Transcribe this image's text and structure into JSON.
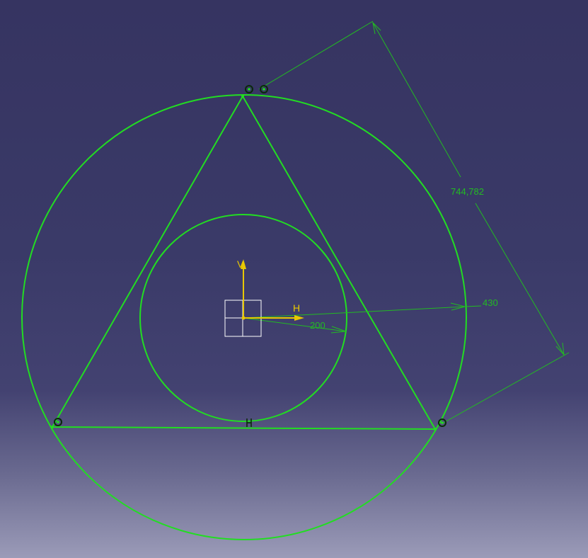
{
  "colors": {
    "geometry": "#22dd22",
    "dimension": "#22bb22",
    "axis": "#e8c800",
    "origin_box": "#ffffff",
    "constraint": "#1a5a1a"
  },
  "dimensions": {
    "side_length": "744,782",
    "outer_radius": "430",
    "inner_radius": "200"
  },
  "axes": {
    "vertical_label": "V",
    "horizontal_label": "H"
  },
  "icons": {
    "coincidence": "coincidence-constraint-icon",
    "horizontal": "horizontal-constraint-icon"
  }
}
